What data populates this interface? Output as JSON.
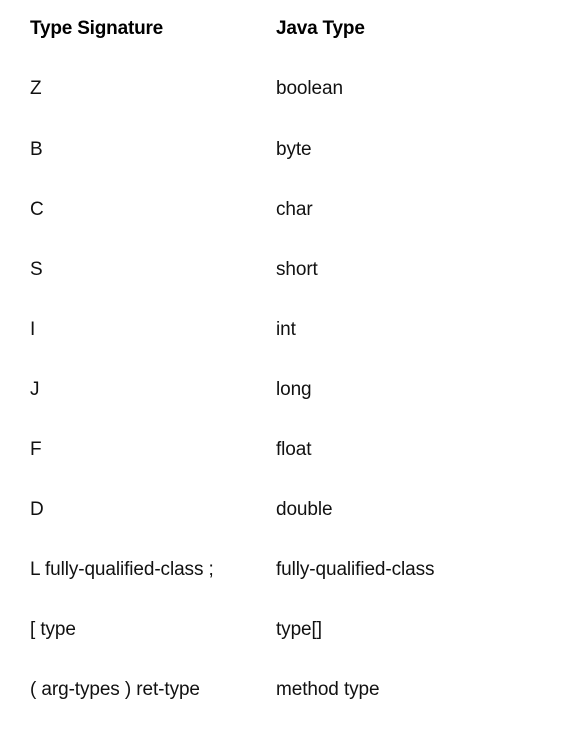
{
  "document": {
    "title": "Type Signature to Java Type mapping table",
    "background_color": "#ffffff",
    "text_color": "#111111"
  },
  "table": {
    "columns": [
      {
        "key": "signature",
        "label": "Type Signature"
      },
      {
        "key": "java_type",
        "label": "Java Type"
      }
    ],
    "rows": [
      {
        "signature": "Z",
        "java_type": "boolean"
      },
      {
        "signature": "B",
        "java_type": "byte"
      },
      {
        "signature": "C",
        "java_type": "char"
      },
      {
        "signature": "S",
        "java_type": "short"
      },
      {
        "signature": "I",
        "java_type": "int"
      },
      {
        "signature": "J",
        "java_type": "long"
      },
      {
        "signature": "F",
        "java_type": "float"
      },
      {
        "signature": "D",
        "java_type": "double"
      },
      {
        "signature": "L fully-qualified-class ;",
        "java_type": "fully-qualified-class"
      },
      {
        "signature": "[ type",
        "java_type": "type[]"
      },
      {
        "signature": "( arg-types ) ret-type",
        "java_type": "method type"
      }
    ]
  }
}
